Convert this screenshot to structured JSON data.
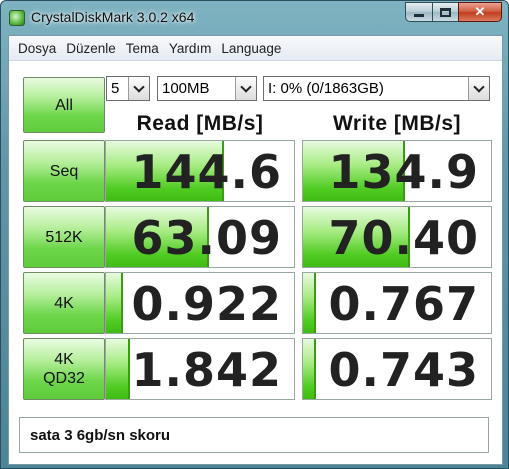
{
  "window": {
    "title": "CrystalDiskMark 3.0.2 x64"
  },
  "menu": [
    "Dosya",
    "Düzenle",
    "Tema",
    "Yardım",
    "Language"
  ],
  "controls": {
    "all_label": "All",
    "count_select": "5",
    "size_select": "100MB",
    "drive_select": "I: 0% (0/1863GB)"
  },
  "headers": {
    "read": "Read [MB/s]",
    "write": "Write [MB/s]"
  },
  "tests": [
    {
      "label": "Seq",
      "read": "144.6",
      "write": "134.9",
      "read_fill": 0.63,
      "write_fill": 0.54
    },
    {
      "label": "512K",
      "read": "63.09",
      "write": "70.40",
      "read_fill": 0.55,
      "write_fill": 0.57
    },
    {
      "label": "4K",
      "read": "0.922",
      "write": "0.767",
      "read_fill": 0.09,
      "write_fill": 0.07
    },
    {
      "label": "4K\nQD32",
      "read": "1.842",
      "write": "0.743",
      "read_fill": 0.13,
      "write_fill": 0.07
    }
  ],
  "comment": "sata 3 6gb/sn skoru",
  "colors": {
    "accent_green": "#4fcb22",
    "frame": "#5f97a8",
    "close_red": "#c03d1f"
  }
}
